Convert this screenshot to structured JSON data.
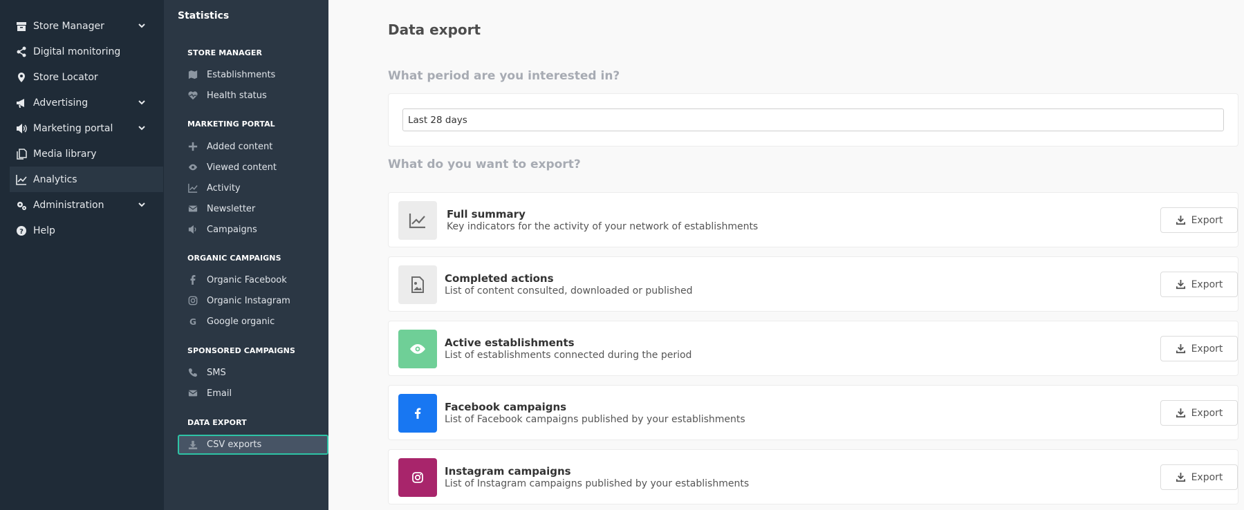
{
  "nav": {
    "items": [
      {
        "label": "Store Manager",
        "icon": "archive-icon",
        "expandable": true
      },
      {
        "label": "Digital monitoring",
        "icon": "share-icon",
        "expandable": false
      },
      {
        "label": "Store Locator",
        "icon": "map-pin-icon",
        "expandable": false
      },
      {
        "label": "Advertising",
        "icon": "bullhorn-icon",
        "expandable": true
      },
      {
        "label": "Marketing portal",
        "icon": "volume-icon",
        "expandable": true
      },
      {
        "label": "Media library",
        "icon": "copy-icon",
        "expandable": false
      },
      {
        "label": "Analytics",
        "icon": "chart-line-icon",
        "expandable": false,
        "active": true
      },
      {
        "label": "Administration",
        "icon": "gears-icon",
        "expandable": true
      },
      {
        "label": "Help",
        "icon": "question-circle-icon",
        "expandable": false
      }
    ]
  },
  "sub": {
    "title": "Statistics",
    "sections": [
      {
        "heading": "STORE MANAGER",
        "items": [
          {
            "label": "Establishments",
            "icon": "map-icon"
          },
          {
            "label": "Health status",
            "icon": "heartbeat-icon"
          }
        ]
      },
      {
        "heading": "MARKETING PORTAL",
        "items": [
          {
            "label": "Added content",
            "icon": "plus-icon"
          },
          {
            "label": "Viewed content",
            "icon": "eye-icon"
          },
          {
            "label": "Activity",
            "icon": "chart-line-icon"
          },
          {
            "label": "Newsletter",
            "icon": "envelope-icon"
          },
          {
            "label": "Campaigns",
            "icon": "volume-icon"
          }
        ]
      },
      {
        "heading": "ORGANIC CAMPAIGNS",
        "items": [
          {
            "label": "Organic Facebook",
            "icon": "facebook-icon"
          },
          {
            "label": "Organic Instagram",
            "icon": "instagram-icon"
          },
          {
            "label": "Google organic",
            "icon": "google-icon"
          }
        ]
      },
      {
        "heading": "SPONSORED CAMPAIGNS",
        "items": [
          {
            "label": "SMS",
            "icon": "phone-icon"
          },
          {
            "label": "Email",
            "icon": "envelope-icon"
          }
        ]
      },
      {
        "heading": "DATA EXPORT",
        "items": [
          {
            "label": "CSV exports",
            "icon": "download-icon",
            "active": true
          }
        ]
      }
    ]
  },
  "main": {
    "title": "Data export",
    "period_question": "What period are you interested in?",
    "period_value": "Last 28 days",
    "export_question": "What do you want to export?",
    "export_label": "Export",
    "exports": [
      {
        "title": "Full summary",
        "desc": "Key indicators for the activity of your network of establishments",
        "icon": "chart-line-icon",
        "color": "#ececec"
      },
      {
        "title": "Completed actions",
        "desc": "List of content consulted, downloaded or published",
        "icon": "file-image-icon",
        "color": "#ececec"
      },
      {
        "title": "Active establishments",
        "desc": "List of establishments connected during the period",
        "icon": "eye-icon",
        "color": "#6fcf97"
      },
      {
        "title": "Facebook campaigns",
        "desc": "List of Facebook campaigns published by your establishments",
        "icon": "facebook-icon",
        "color": "#1877f2"
      },
      {
        "title": "Instagram campaigns",
        "desc": "List of Instagram campaigns published by your establishments",
        "icon": "instagram-icon",
        "color": "#a8256b"
      }
    ]
  }
}
